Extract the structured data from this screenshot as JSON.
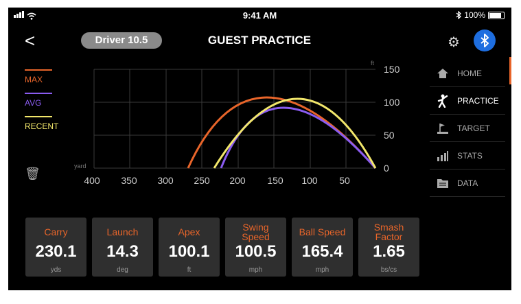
{
  "status_bar": {
    "time": "9:41 AM",
    "battery": "100%"
  },
  "header": {
    "back": "<",
    "club": "Driver 10.5",
    "title": "GUEST PRACTICE"
  },
  "legend": [
    {
      "label": "MAX",
      "color": "#e8652a"
    },
    {
      "label": "AVG",
      "color": "#8a5cf0"
    },
    {
      "label": "RECENT",
      "color": "#f2e76b"
    }
  ],
  "chart": {
    "x_unit": "yard",
    "y_unit": "ft",
    "x_ticks": [
      "400",
      "350",
      "300",
      "250",
      "200",
      "150",
      "100",
      "50"
    ],
    "y_ticks": [
      "150",
      "100",
      "50",
      "0"
    ]
  },
  "nav": [
    {
      "label": "HOME",
      "icon": "home-icon",
      "active": false
    },
    {
      "label": "PRACTICE",
      "icon": "golfer-icon",
      "active": true
    },
    {
      "label": "TARGET",
      "icon": "target-flag-icon",
      "active": false
    },
    {
      "label": "STATS",
      "icon": "stats-icon",
      "active": false
    },
    {
      "label": "DATA",
      "icon": "data-folder-icon",
      "active": false
    }
  ],
  "metrics": [
    {
      "label": "Carry",
      "value": "230.1",
      "unit": "yds"
    },
    {
      "label": "Launch",
      "value": "14.3",
      "unit": "deg"
    },
    {
      "label": "Apex",
      "value": "100.1",
      "unit": "ft"
    },
    {
      "label": "Swing Speed",
      "value": "100.5",
      "unit": "mph"
    },
    {
      "label": "Ball Speed",
      "value": "165.4",
      "unit": "mph"
    },
    {
      "label": "Smash Factor",
      "value": "1.65",
      "unit": "bs/cs"
    }
  ]
}
